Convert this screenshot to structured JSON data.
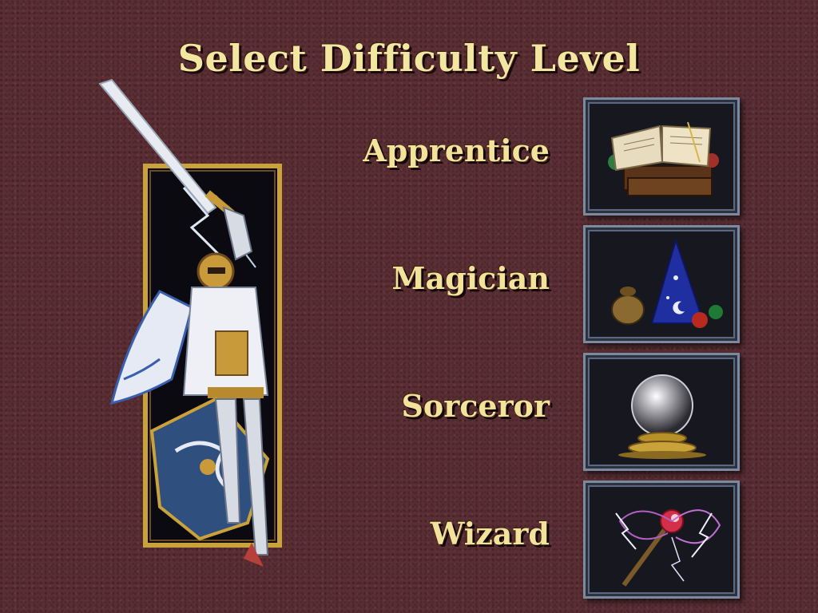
{
  "title": "Select Difficulty Level",
  "difficulties": [
    {
      "label": "Apprentice",
      "icon": "spellbook-icon"
    },
    {
      "label": "Magician",
      "icon": "wizard-hat-icon"
    },
    {
      "label": "Sorceror",
      "icon": "crystal-ball-icon"
    },
    {
      "label": "Wizard",
      "icon": "magic-staff-icon"
    }
  ],
  "colors": {
    "background": "#5a2e33",
    "text": "#f3e29a",
    "frame_border": "#7c8aa0",
    "hero_frame": "#c9a23a"
  }
}
